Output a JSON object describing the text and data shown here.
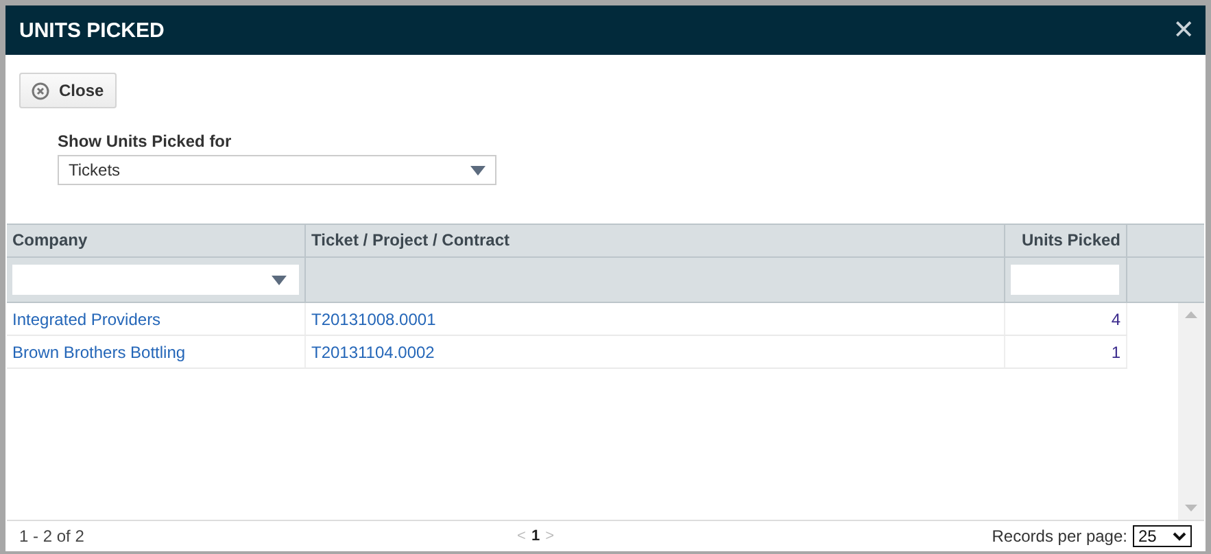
{
  "window": {
    "title": "UNITS PICKED",
    "close_glyph": "✕"
  },
  "toolbar": {
    "close_button": "Close"
  },
  "filter": {
    "label": "Show Units Picked for",
    "value": "Tickets"
  },
  "table": {
    "columns": [
      {
        "label": "Company",
        "kind": "dropdown"
      },
      {
        "label": "Ticket / Project / Contract",
        "kind": "plain"
      },
      {
        "label": "Units Picked",
        "kind": "number"
      }
    ],
    "rows": [
      {
        "company": "Integrated Providers",
        "ticket": "T20131008.0001",
        "units": "4"
      },
      {
        "company": "Brown Brothers Bottling",
        "ticket": "T20131104.0002",
        "units": "1"
      }
    ]
  },
  "footer": {
    "range": "1 - 2 of 2",
    "pager": [
      {
        "text": "<",
        "disabled": true
      },
      {
        "text": "1",
        "selected": true
      },
      {
        "text": ">",
        "disabled": true
      }
    ],
    "records_label": "Records per page:",
    "page_size": "25"
  }
}
